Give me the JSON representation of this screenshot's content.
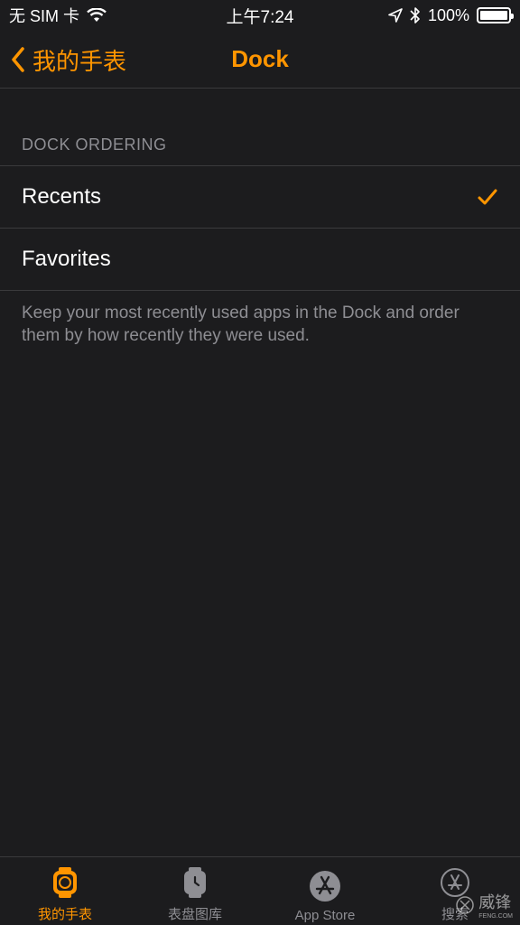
{
  "status_bar": {
    "carrier": "无 SIM 卡",
    "wifi_icon": "wifi-icon",
    "time": "上午7:24",
    "location_icon": "location-arrow-icon",
    "bluetooth_icon": "bluetooth-icon",
    "battery_percent": "100%",
    "battery_level": 1.0
  },
  "nav": {
    "back_label": "我的手表",
    "title": "Dock"
  },
  "section": {
    "header": "DOCK ORDERING",
    "options": [
      {
        "label": "Recents",
        "selected": true
      },
      {
        "label": "Favorites",
        "selected": false
      }
    ],
    "footer": "Keep your most recently used apps in the Dock and order them by how recently they were used."
  },
  "tab_bar": {
    "tabs": [
      {
        "label": "我的手表",
        "icon": "watch-icon",
        "active": true
      },
      {
        "label": "表盘图库",
        "icon": "watch-face-gallery-icon",
        "active": false
      },
      {
        "label": "App Store",
        "icon": "app-store-icon",
        "active": false
      },
      {
        "label": "搜索",
        "icon": "search-icon",
        "active": false
      }
    ]
  },
  "watermark": {
    "text": "威锋",
    "sub": "FENG.COM"
  },
  "colors": {
    "accent": "#ff9500",
    "background": "#1c1c1e",
    "separator": "#3a3a3c",
    "secondary_text": "#8e8e93"
  }
}
